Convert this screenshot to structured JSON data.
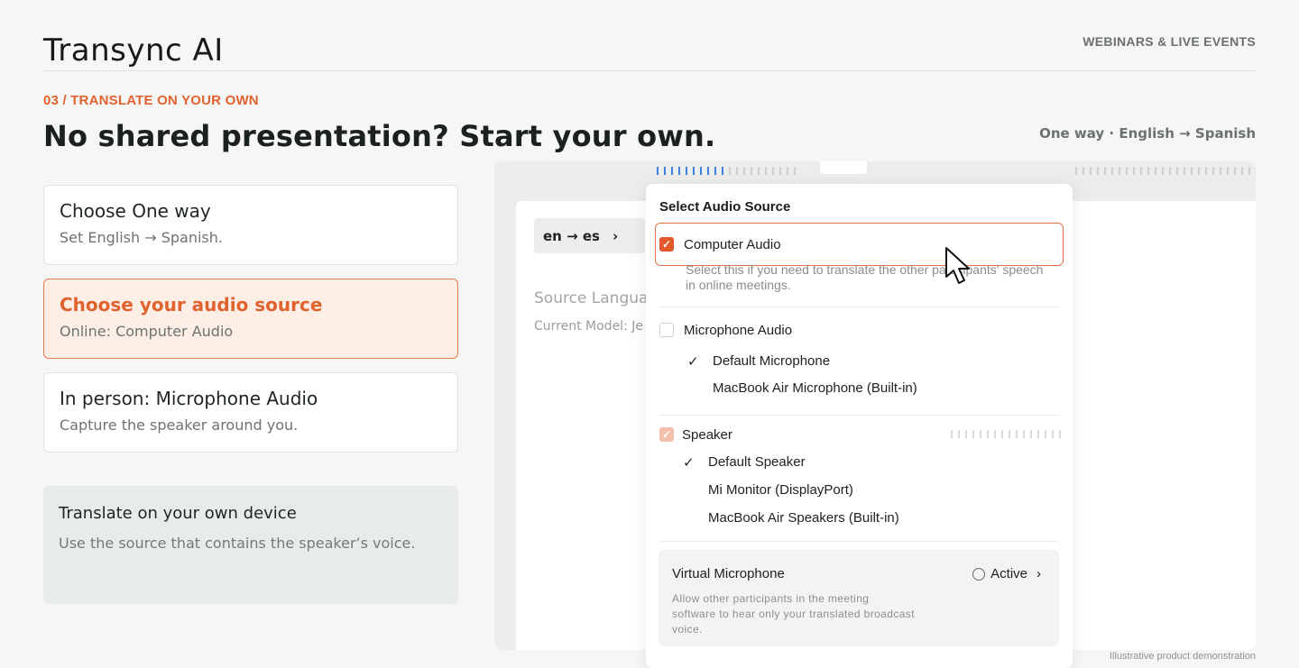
{
  "brand": "Transync AI",
  "nav": {
    "label": "WEBINARS & LIVE EVENTS"
  },
  "section": {
    "label": "03 / TRANSLATE ON YOUR OWN"
  },
  "headline": "No shared presentation? Start your own.",
  "mode_tag": "One way · English → Spanish",
  "steps": [
    {
      "title": "Choose One way",
      "subtitle": "Set English → Spanish.",
      "active": false
    },
    {
      "title": "Choose your audio source",
      "subtitle": "Online: Computer Audio",
      "active": true
    },
    {
      "title": "In person: Microphone Audio",
      "subtitle": "Capture the speaker around you.",
      "active": false
    }
  ],
  "info": {
    "title": "Translate on your own device",
    "text": "Use the source that contains the speaker’s voice."
  },
  "demo": {
    "lang_pair": "en → es",
    "chevron": "›",
    "source_language": "Source Languag",
    "current_model": "Current Model: Je"
  },
  "panel": {
    "title": "Select Audio Source",
    "computer_audio": {
      "label": "Computer Audio",
      "desc": "Select this if you need to translate the other participants' speech in online meetings.",
      "checked": true
    },
    "microphone": {
      "label": "Microphone Audio",
      "checked": false,
      "devices": [
        "Default Microphone",
        "MacBook Air Microphone (Built-in)"
      ],
      "selected_index": 0
    },
    "speaker": {
      "label": "Speaker",
      "checked": true,
      "devices": [
        "Default Speaker",
        "Mi Monitor (DisplayPort)",
        "MacBook Air Speakers (Built-in)"
      ],
      "selected_index": 0
    },
    "virtual_mic": {
      "title": "Virtual Microphone",
      "status": "Active",
      "chevron": "›",
      "desc": "Allow other participants in the meeting software to hear only your translated broadcast voice."
    }
  },
  "colors": {
    "accent": "#e0622f",
    "active_bg": "#fdeee6",
    "meter_active": "#3d7ee0"
  },
  "footnote": "Illustrative product demonstration"
}
